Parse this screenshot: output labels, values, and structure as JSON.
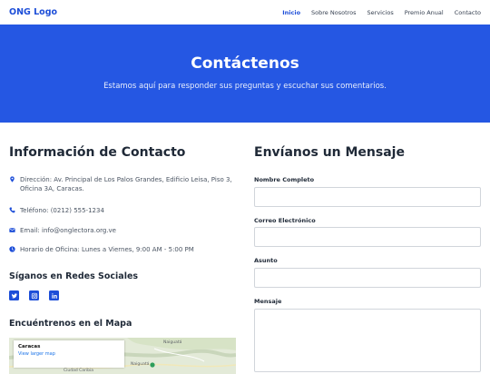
{
  "nav": {
    "logo": "ONG Logo",
    "links": [
      "Inicio",
      "Sobre Nosotros",
      "Servicios",
      "Premio Anual",
      "Contacto"
    ]
  },
  "hero": {
    "title": "Contáctenos",
    "subtitle": "Estamos aquí para responder sus preguntas y escuchar sus comentarios."
  },
  "contact": {
    "title": "Información de Contacto",
    "items": [
      {
        "icon": "map-marker-icon",
        "text": "Dirección: Av. Principal de Los Palos Grandes, Edificio Leisa, Piso 3, Oficina 3A, Caracas."
      },
      {
        "icon": "phone-icon",
        "text": "Teléfono: (0212) 555-1234"
      },
      {
        "icon": "envelope-icon",
        "text": "Email: info@onglectora.org.ve"
      },
      {
        "icon": "clock-icon",
        "text": "Horario de Oficina: Lunes a Viernes, 9:00 AM - 5:00 PM"
      }
    ],
    "social_title": "Síganos en Redes Sociales",
    "socials": [
      "twitter-icon",
      "instagram-icon",
      "linkedin-icon"
    ],
    "map_title": "Encuéntrenos en el Mapa",
    "map": {
      "place": "Caracas",
      "link": "View larger map",
      "labels": [
        "Naiguatá",
        "Naiguatá",
        "Ciudad Caribia"
      ]
    }
  },
  "form": {
    "title": "Envíanos un Mensaje",
    "fields": [
      {
        "label": "Nombre Completo"
      },
      {
        "label": "Correo Electrónico"
      },
      {
        "label": "Asunto"
      },
      {
        "label": "Mensaje"
      }
    ]
  },
  "colors": {
    "primary": "#2557e3",
    "brand": "#1d4ed8"
  }
}
